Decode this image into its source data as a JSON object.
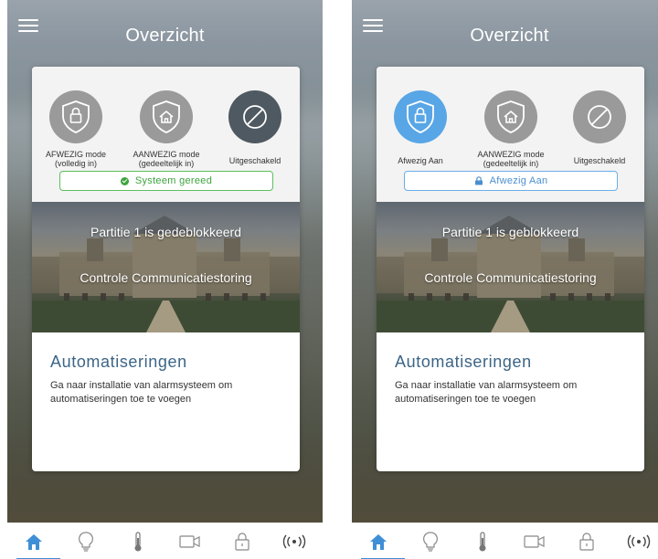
{
  "screens": [
    {
      "title": "Overzicht",
      "modes": [
        {
          "label_line1": "AFWEZIG mode",
          "label_line2": "(volledig in)",
          "state": "inactive",
          "icon": "shield-lock-icon"
        },
        {
          "label_line1": "AANWEZIG mode",
          "label_line2": "(gedeeltelijk in)",
          "state": "inactive",
          "icon": "shield-home-icon"
        },
        {
          "label_line1": "Uitgeschakeld",
          "label_line2": "",
          "state": "selected-dark",
          "icon": "disabled-icon"
        }
      ],
      "status": {
        "text": "Systeem gereed",
        "color": "#3da43d"
      },
      "photo_lines": [
        "Partitie 1 is gedeblokkeerd",
        "Controle Communicatiestoring"
      ],
      "automations": {
        "heading": "Automatiseringen",
        "text": "Ga naar installatie van alarmsysteem om automatiseringen toe te voegen"
      }
    },
    {
      "title": "Overzicht",
      "modes": [
        {
          "label_line1": "Afwezig Aan",
          "label_line2": "",
          "state": "selected-blue",
          "icon": "shield-lock-icon"
        },
        {
          "label_line1": "AANWEZIG mode",
          "label_line2": "(gedeeltelijk in)",
          "state": "inactive",
          "icon": "shield-home-icon"
        },
        {
          "label_line1": "Uitgeschakeld",
          "label_line2": "",
          "state": "inactive",
          "icon": "disabled-icon"
        }
      ],
      "status": {
        "text": "Afwezig Aan",
        "color": "#4a8fd0"
      },
      "photo_lines": [
        "Partitie 1 is geblokkeerd",
        "Controle Communicatiestoring"
      ],
      "automations": {
        "heading": "Automatiseringen",
        "text": "Ga naar installatie van alarmsysteem om automatiseringen toe te voegen"
      }
    }
  ],
  "tabbar": {
    "accent": "#3e8fd6",
    "items": [
      "home-icon",
      "lightbulb-icon",
      "thermometer-icon",
      "camera-icon",
      "lock-icon",
      "wireless-icon"
    ],
    "active": "home-icon"
  }
}
